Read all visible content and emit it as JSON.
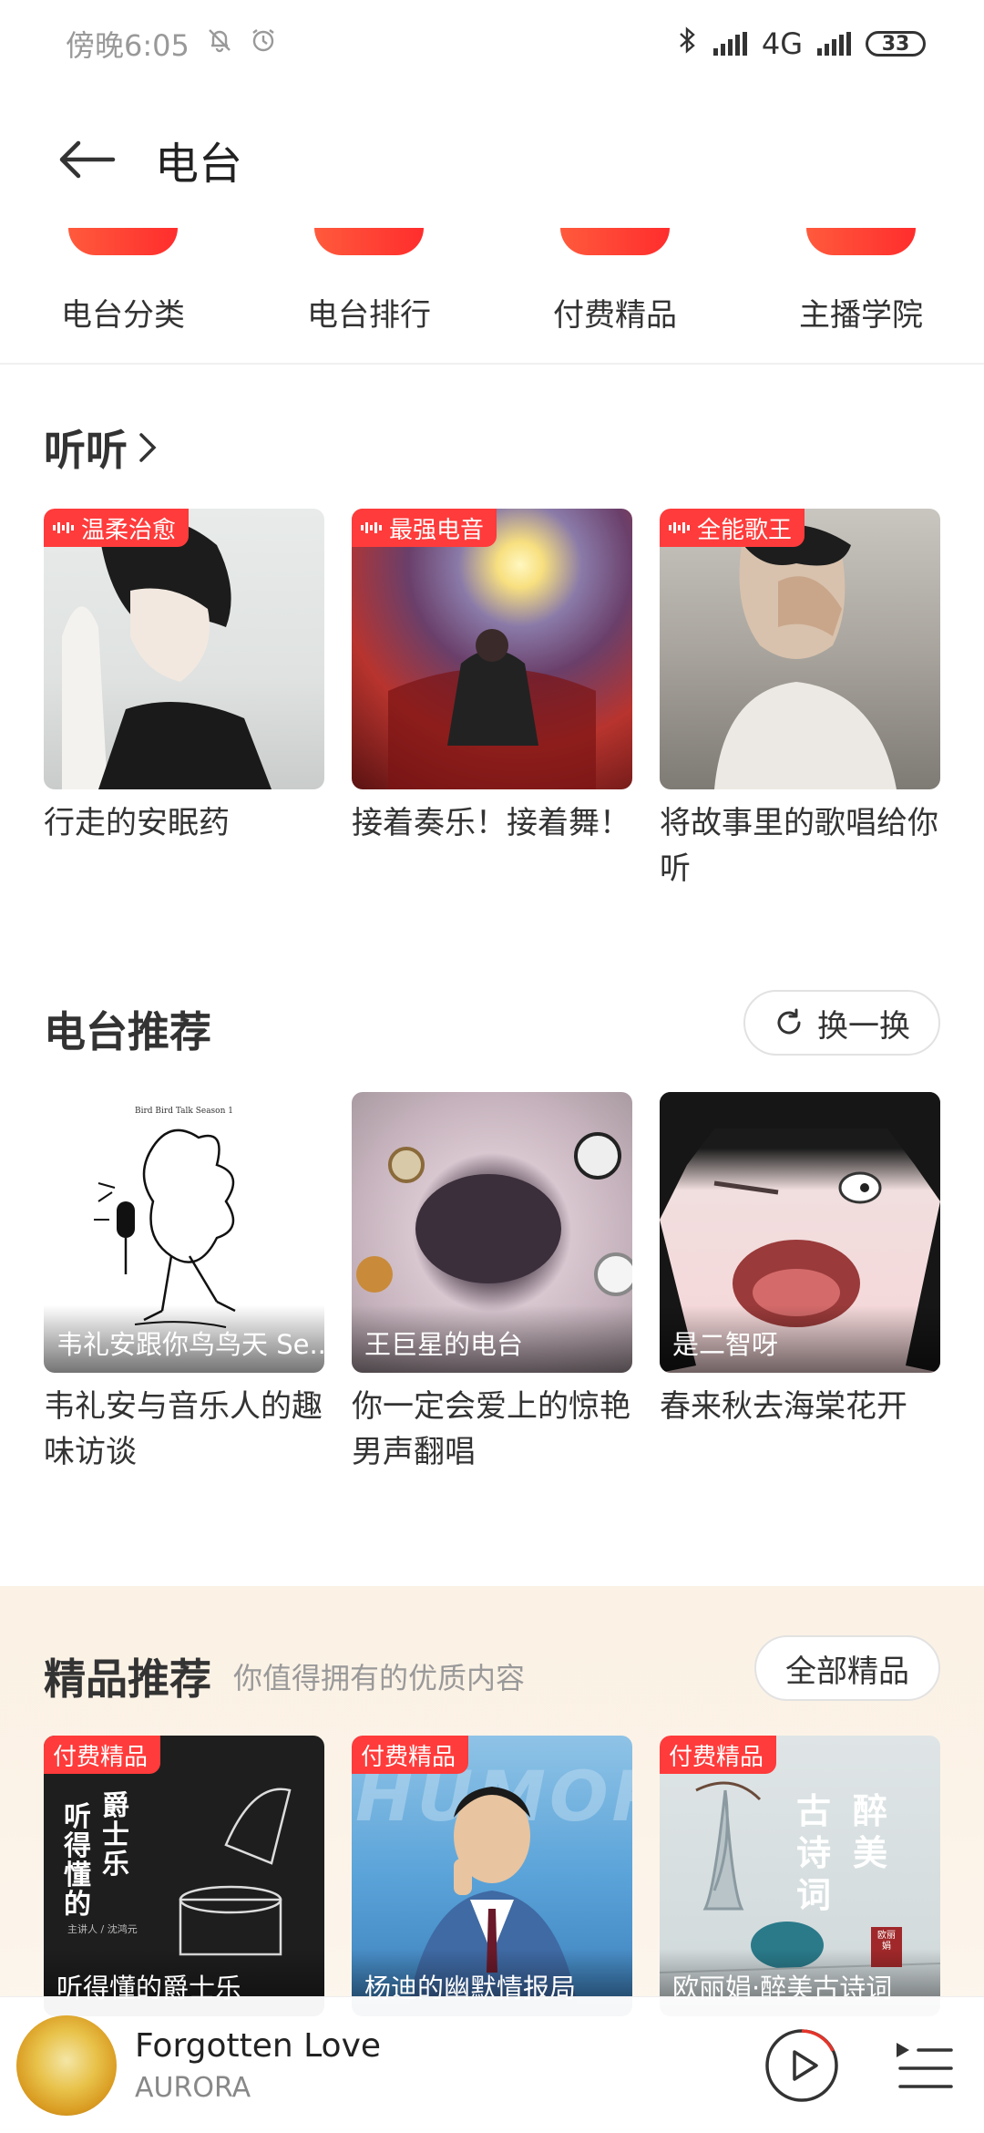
{
  "status": {
    "time": "傍晚6:05",
    "network": "4G",
    "battery": "33"
  },
  "header": {
    "title": "电台"
  },
  "categories": [
    {
      "label": "电台分类"
    },
    {
      "label": "电台排行"
    },
    {
      "label": "付费精品"
    },
    {
      "label": "主播学院"
    }
  ],
  "listen": {
    "title": "听听",
    "cards": [
      {
        "tag": "温柔治愈",
        "title": "行走的安眠药"
      },
      {
        "tag": "最强电音",
        "title": "接着奏乐！接着舞！"
      },
      {
        "tag": "全能歌王",
        "title": "将故事里的歌唱给你听"
      }
    ]
  },
  "recommend": {
    "title": "电台推荐",
    "refresh_label": "换一换",
    "cards": [
      {
        "overlay": "韦礼安跟你鸟鸟天 Se...",
        "cover_text": "Bird Bird Talk Season 1",
        "title": "韦礼安与音乐人的趣味访谈"
      },
      {
        "overlay": "王巨星的电台",
        "title": "你一定会爱上的惊艳男声翻唱"
      },
      {
        "overlay": "是二智呀",
        "title": "春来秋去海棠花开"
      }
    ]
  },
  "premium": {
    "title": "精品推荐",
    "subtitle": "你值得拥有的优质内容",
    "all_label": "全部精品",
    "cards": [
      {
        "tag": "付费精品",
        "overlay": "听得懂的爵士乐",
        "cover_line1": "爵士乐",
        "cover_line2": "听得懂的",
        "cover_host": "主讲人 / 沈鸿元"
      },
      {
        "tag": "付费精品",
        "overlay": "杨迪的幽默情报局",
        "cover_bg": "HUMOR"
      },
      {
        "tag": "付费精品",
        "overlay": "欧丽娟·醉美古诗词",
        "cover_line1": "醉美",
        "cover_line2": "古诗词",
        "cover_seal": "欧丽娟"
      }
    ]
  },
  "player": {
    "song": "Forgotten Love",
    "artist": "AURORA"
  }
}
